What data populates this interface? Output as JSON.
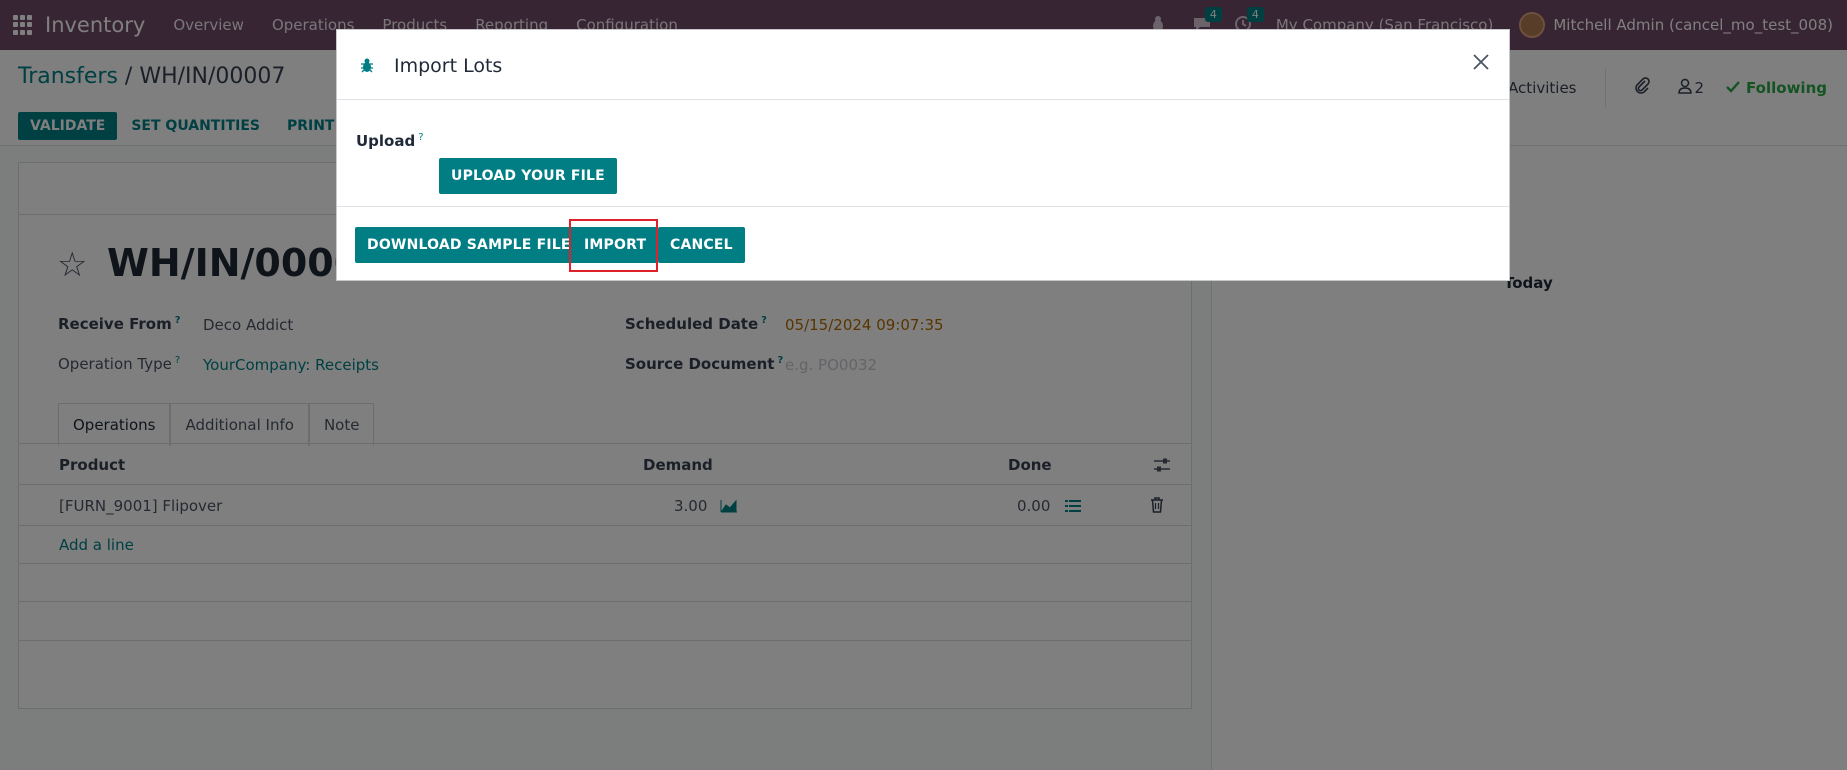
{
  "navbar": {
    "brand": "Inventory",
    "menu": [
      "Overview",
      "Operations",
      "Products",
      "Reporting",
      "Configuration"
    ],
    "messages_count": "4",
    "activities_count": "4",
    "company": "My Company (San Francisco)",
    "user": "Mitchell Admin (cancel_mo_test_008)"
  },
  "control_panel": {
    "breadcrumb_parent": "Transfers",
    "breadcrumb_separator": " / ",
    "breadcrumb_current": "WH/IN/00007",
    "validate_label": "VALIDATE",
    "set_quantities_label": "SET QUANTITIES",
    "print_label": "PRINT",
    "activities_label": "Activities",
    "followers_count": "2",
    "following_label": "Following"
  },
  "form": {
    "title": "WH/IN/00007",
    "receive_from_label": "Receive From",
    "receive_from_value": "Deco Addict",
    "operation_type_label": "Operation Type",
    "operation_type_value": "YourCompany: Receipts",
    "scheduled_date_label": "Scheduled Date",
    "scheduled_date_value": "05/15/2024 09:07:35",
    "source_document_label": "Source Document",
    "source_document_placeholder": "e.g. PO0032",
    "tabs": [
      "Operations",
      "Additional Info",
      "Note"
    ],
    "table": {
      "headers": {
        "product": "Product",
        "demand": "Demand",
        "done": "Done"
      },
      "rows": [
        {
          "product": "[FURN_9001] Flipover",
          "demand": "3.00",
          "done": "0.00"
        }
      ],
      "add_line": "Add a line"
    }
  },
  "chatter": {
    "today_label": "Today"
  },
  "modal": {
    "title": "Import Lots",
    "upload_label": "Upload",
    "help_mark": "?",
    "upload_button": "UPLOAD YOUR FILE",
    "download_sample_button": "DOWNLOAD SAMPLE FILE",
    "import_button": "IMPORT",
    "cancel_button": "CANCEL"
  },
  "colors": {
    "primary": "#017e84",
    "navbar": "#714b67",
    "highlight": "#e0202a"
  }
}
